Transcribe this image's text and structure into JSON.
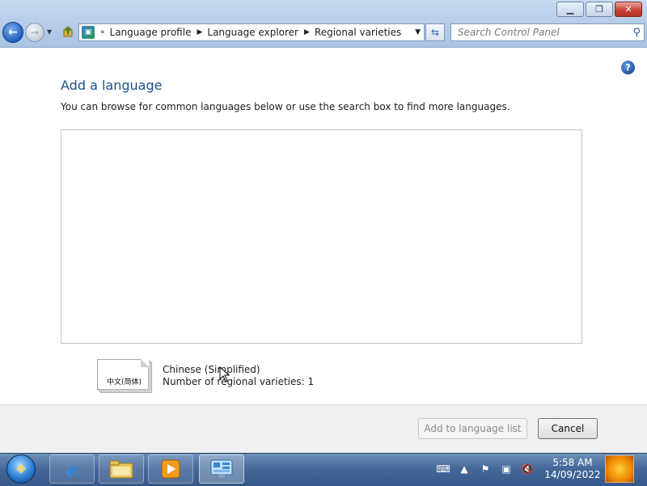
{
  "window": {
    "caption_buttons": {
      "minimize_icon": "minimize-icon",
      "restore_icon": "restore-icon",
      "close_icon": "close-icon"
    }
  },
  "navigation": {
    "breadcrumb": {
      "overflow": "«",
      "items": [
        "Language profile",
        "Language explorer",
        "Regional varieties"
      ]
    },
    "search": {
      "placeholder": "Search Control Panel"
    }
  },
  "content": {
    "title": "Add a language",
    "description": "You can browse for common languages below or use the search box to find more languages.",
    "selected_language": {
      "tile_glyphs": "中文(简体)",
      "name": "Chinese (Simplified)",
      "detail": "Number of regional varieties: 1"
    }
  },
  "footer": {
    "add_label": "Add to language list",
    "cancel_label": "Cancel"
  },
  "taskbar": {
    "clock_time": "5:58 AM",
    "clock_date": "14/09/2022",
    "pinned": [
      "internet-explorer-icon",
      "windows-explorer-icon",
      "media-player-icon",
      "control-panel-icon"
    ]
  },
  "colors": {
    "title_blue": "#1e4e8c",
    "taskbar": "#46699a",
    "disabled_text": "#8b8b8b"
  }
}
